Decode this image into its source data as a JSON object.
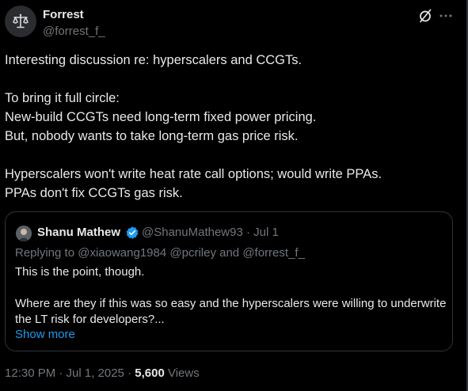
{
  "author": {
    "name": "Forrest",
    "handle": "@forrest_f_",
    "avatar_icon": "balance-scale-icon"
  },
  "header_actions": {
    "grok_icon": "grok-slash-circle-icon",
    "more_icon": "more-horizontal-icon"
  },
  "tweet": {
    "lines": [
      "Interesting discussion re: hyperscalers and CCGTs.",
      "",
      "To bring it full circle:",
      "New-build CCGTs need long-term fixed power pricing.",
      "But, nobody wants to take long-term gas price risk.",
      "",
      "Hyperscalers won't write heat rate call options; would write PPAs.",
      "PPAs don't fix CCGTs gas risk."
    ]
  },
  "quote": {
    "name": "Shanu Mathew",
    "handle_date": "@ShanuMathew93 · Jul 1",
    "verified_icon": "verified-badge-icon",
    "reply_prefix": "Replying to ",
    "mentions": [
      "@xiaowang1984",
      "@pcriley",
      "@forrest_f_"
    ],
    "reply_joiner": " and ",
    "body_lines": [
      "This is the point, though.",
      "",
      "Where are they if this was so easy and the hyperscalers were willing to underwrite",
      "the LT risk for developers?..."
    ],
    "show_more": "Show more"
  },
  "meta": {
    "time_date": "12:30 PM · Jul 1, 2025 · ",
    "views_count": "5,600",
    "views_label": " Views"
  },
  "colors": {
    "background": "#000000",
    "text_primary": "#e7e9ea",
    "text_secondary": "#71767b",
    "accent_blue": "#1d9bf0",
    "border": "#2f3336"
  }
}
